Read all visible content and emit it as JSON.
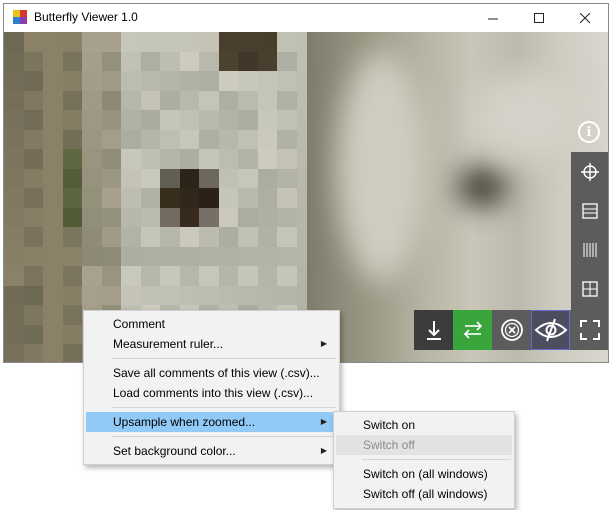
{
  "window": {
    "title": "Butterfly Viewer 1.0",
    "controls": {
      "minimize": "—",
      "maximize": "☐",
      "close": "✕"
    }
  },
  "toolbar": {
    "info_symbol": "i",
    "side_buttons": [
      "crosshair-icon",
      "horizontal-split-icon",
      "vertical-split-icon",
      "grid-icon"
    ],
    "bottom_buttons": [
      {
        "icon": "download-icon",
        "bg": "#3c3c3c"
      },
      {
        "icon": "sync-arrows-icon",
        "bg": "#3aa53a"
      },
      {
        "icon": "close-circle-icon",
        "bg": "#5c5c5c"
      },
      {
        "icon": "eye-slash-icon",
        "bg": "#4d4d60"
      },
      {
        "icon": "fullscreen-icon",
        "bg": "#5c5c5c"
      }
    ]
  },
  "context_menu": {
    "items": [
      {
        "label": "Comment",
        "submenu": false
      },
      {
        "label": "Measurement ruler...",
        "submenu": true
      },
      {
        "label": "Save all comments of this view (.csv)...",
        "submenu": false
      },
      {
        "label": "Load comments into this view (.csv)...",
        "submenu": false
      },
      {
        "label": "Upsample when zoomed...",
        "submenu": true,
        "highlighted": true
      },
      {
        "label": "Set background color...",
        "submenu": true
      }
    ],
    "submenu_arrow": "▶"
  },
  "submenu": {
    "items": [
      {
        "label": "Switch on",
        "enabled": true
      },
      {
        "label": "Switch off",
        "enabled": false
      },
      {
        "label": "Switch on (all windows)",
        "enabled": true
      },
      {
        "label": "Switch off (all windows)",
        "enabled": true
      }
    ]
  },
  "colors": {
    "highlight": "#91c9f7",
    "menu_bg": "#f2f2f2",
    "toolbar_bg": "#5c5c5c",
    "sync_button": "#3aa53a"
  }
}
